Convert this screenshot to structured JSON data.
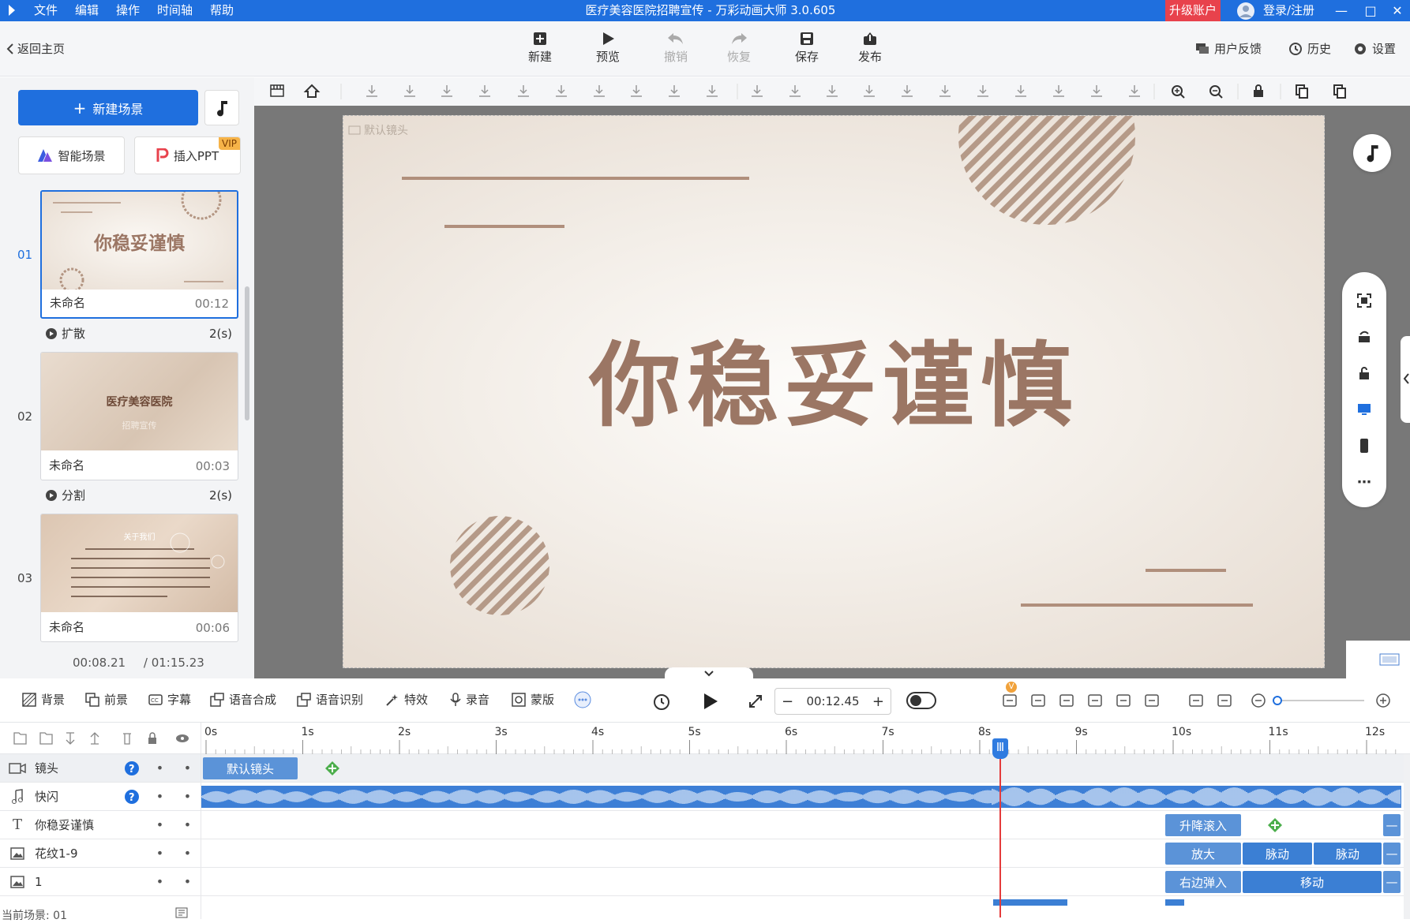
{
  "titlebar": {
    "menu": [
      "文件",
      "编辑",
      "操作",
      "时间轴",
      "帮助"
    ],
    "title": "医疗美容医院招聘宣传 - 万彩动画大师 3.0.605",
    "upgrade": "升级账户",
    "login": "登录/注册"
  },
  "toolbar": {
    "back": "返回主页",
    "new": "新建",
    "preview": "预览",
    "undo": "撤销",
    "redo": "恢复",
    "save": "保存",
    "publish": "发布",
    "feedback": "用户反馈",
    "history": "历史",
    "settings": "设置"
  },
  "left_panel": {
    "new_scene": "新建场景",
    "smart_scene": "智能场景",
    "insert_ppt": "插入PPT",
    "vip": "VIP",
    "scenes": [
      {
        "num": "01",
        "name": "未命名",
        "time": "00:12",
        "thumb_title": "你稳妥谨慎"
      },
      {
        "num": "02",
        "name": "未命名",
        "time": "00:03",
        "thumb_title": "医疗美容医院",
        "thumb_sub": "招聘宣传"
      },
      {
        "num": "03",
        "name": "未命名",
        "time": "00:06",
        "thumb_title": "关于我们"
      }
    ],
    "transitions": [
      {
        "name": "扩散",
        "dur": "2(s)"
      },
      {
        "name": "分割",
        "dur": "2(s)"
      }
    ],
    "current_time": "00:08.21",
    "total_time": "/ 01:15.23"
  },
  "stage": {
    "lens_label": "默认镜头",
    "title": "你稳妥谨慎"
  },
  "bottom_toolbar": {
    "background": "背景",
    "foreground": "前景",
    "subtitle": "字幕",
    "tts": "语音合成",
    "asr": "语音识别",
    "effects": "特效",
    "record": "录音",
    "mask": "蒙版",
    "time": "00:12.45",
    "badge": "V"
  },
  "timeline": {
    "ruler": [
      "0s",
      "1s",
      "2s",
      "3s",
      "4s",
      "5s",
      "6s",
      "7s",
      "8s",
      "9s",
      "10s",
      "11s",
      "12s"
    ],
    "tracks": [
      {
        "name": "镜头",
        "clips": [
          "默认镜头"
        ]
      },
      {
        "name": "快闪",
        "clips": []
      },
      {
        "name": "你稳妥谨慎",
        "clips": [
          "升降滚入"
        ]
      },
      {
        "name": "花纹1-9",
        "clips": [
          "放大",
          "脉动",
          "脉动"
        ]
      },
      {
        "name": "1",
        "clips": [
          "右边弹入",
          "移动"
        ]
      }
    ],
    "status": "当前场景: 01",
    "playhead_seconds": 8.21
  },
  "colors": {
    "accent": "#1f6fde",
    "clip": "#5b93d8",
    "title_brown": "#9b7664",
    "upgrade_red": "#e8424c"
  }
}
